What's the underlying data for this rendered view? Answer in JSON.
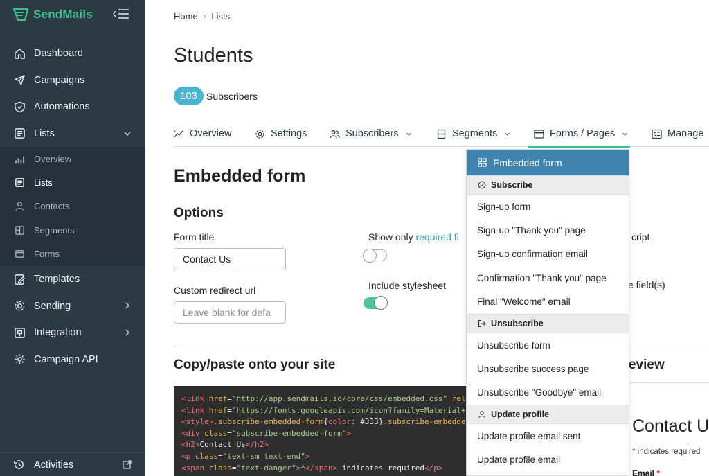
{
  "app": {
    "name": "SendMails",
    "brand_color": "#40c08f",
    "sidebar_bg": "#2c3a44"
  },
  "sidebar": {
    "items": [
      {
        "label": "Dashboard",
        "icon": "home-icon"
      },
      {
        "label": "Campaigns",
        "icon": "send-icon"
      },
      {
        "label": "Automations",
        "icon": "shield-check-icon"
      },
      {
        "label": "Lists",
        "icon": "list-icon",
        "expanded": true
      },
      {
        "label": "Templates",
        "icon": "edit-icon"
      },
      {
        "label": "Sending",
        "icon": "gear-icon"
      },
      {
        "label": "Integration",
        "icon": "plug-icon"
      },
      {
        "label": "Campaign API",
        "icon": "cog-icon"
      }
    ],
    "sub_items": [
      {
        "label": "Overview",
        "icon": "chart-icon"
      },
      {
        "label": "Lists",
        "icon": "list-icon",
        "active": true
      },
      {
        "label": "Contacts",
        "icon": "user-icon"
      },
      {
        "label": "Segments",
        "icon": "segment-icon"
      },
      {
        "label": "Forms",
        "icon": "form-icon"
      }
    ],
    "footer": {
      "label": "Activities",
      "icon": "history-icon"
    }
  },
  "breadcrumb": {
    "home": "Home",
    "sep": "›",
    "current": "Lists"
  },
  "page": {
    "title": "Students",
    "subscriber_count": "103",
    "subscriber_label": "Subscribers"
  },
  "tabs": [
    {
      "label": "Overview",
      "icon": "chart-line-icon"
    },
    {
      "label": "Settings",
      "icon": "gear-icon"
    },
    {
      "label": "Subscribers",
      "icon": "users-icon"
    },
    {
      "label": "Segments",
      "icon": "segments-icon"
    },
    {
      "label": "Forms / Pages",
      "icon": "window-icon",
      "active": true
    },
    {
      "label": "Manage",
      "icon": "checklist-icon"
    }
  ],
  "section": {
    "title": "Embedded form",
    "options_title": "Options"
  },
  "options": {
    "form_title_label": "Form title",
    "form_title_value": "Contact Us",
    "redirect_label": "Custom redirect url",
    "redirect_placeholder": "Leave blank for defa",
    "required_only_prefix": "Show only ",
    "required_only_link": "required fi",
    "required_only_on": false,
    "stylesheet_label": "Include stylesheet",
    "stylesheet_on": true,
    "partial_1": "cript",
    "partial_2": "e field(s)"
  },
  "copy": {
    "title": "Copy/paste onto your site",
    "preview_title_partial": "eview",
    "code_lines": [
      [
        {
          "c": "t",
          "v": "<link "
        },
        {
          "c": "a",
          "v": "href"
        },
        {
          "c": "",
          "v": "="
        },
        {
          "c": "s",
          "v": "\"http://app.sendmails.io/core/css/embedded.css\""
        },
        {
          "c": "",
          "v": " "
        },
        {
          "c": "a",
          "v": "rel="
        }
      ],
      [
        {
          "c": "t",
          "v": "<link "
        },
        {
          "c": "a",
          "v": "href"
        },
        {
          "c": "",
          "v": "="
        },
        {
          "c": "s",
          "v": "\"https://fonts.googleapis.com/icon?family=Material+I"
        }
      ],
      [
        {
          "c": "t",
          "v": "<style>"
        },
        {
          "c": "a",
          "v": ".subscribe-embedded-form"
        },
        {
          "c": "",
          "v": "{"
        },
        {
          "c": "t",
          "v": "color"
        },
        {
          "c": "",
          "v": ": #333}"
        },
        {
          "c": "a",
          "v": ".subscribe-embedded"
        }
      ],
      [
        {
          "c": "t",
          "v": "<div "
        },
        {
          "c": "a",
          "v": "class"
        },
        {
          "c": "",
          "v": "="
        },
        {
          "c": "s",
          "v": "\"subscribe-embedded-form\""
        },
        {
          "c": "t",
          "v": ">"
        }
      ],
      [
        {
          "c": "t",
          "v": "<h2>"
        },
        {
          "c": "",
          "v": "Contact Us"
        },
        {
          "c": "t",
          "v": "</h2>"
        }
      ],
      [
        {
          "c": "t",
          "v": "<p "
        },
        {
          "c": "a",
          "v": "class"
        },
        {
          "c": "",
          "v": "="
        },
        {
          "c": "s",
          "v": "\"text-sm text-end\""
        },
        {
          "c": "t",
          "v": ">"
        }
      ],
      [
        {
          "c": "t",
          "v": "<span "
        },
        {
          "c": "a",
          "v": "class"
        },
        {
          "c": "",
          "v": "="
        },
        {
          "c": "s",
          "v": "\"text-danger\""
        },
        {
          "c": "t",
          "v": ">"
        },
        {
          "c": "",
          "v": "*"
        },
        {
          "c": "t",
          "v": "</span>"
        },
        {
          "c": "",
          "v": " indicates required"
        },
        {
          "c": "t",
          "v": "</p>"
        }
      ]
    ]
  },
  "preview": {
    "title": "Contact U",
    "required_star": "*",
    "required_text": " indicates required",
    "email_label": "Email",
    "email_star": "*"
  },
  "dropdown": {
    "active_item": "Embedded form",
    "groups": [
      {
        "header": "Subscribe",
        "icon": "check-circle-icon",
        "items": [
          "Sign-up form",
          "Sign-up \"Thank you\" page",
          "Sign-up confirmation email",
          "Confirmation \"Thank you\" page",
          "Final \"Welcome\" email"
        ]
      },
      {
        "header": "Unsubscribe",
        "icon": "logout-icon",
        "items": [
          "Unsubscribe form",
          "Unsubscribe success page",
          "Unsubscribe \"Goodbye\" email"
        ]
      },
      {
        "header": "Update profile",
        "icon": "person-icon",
        "items": [
          "Update profile email sent",
          "Update profile email"
        ]
      }
    ],
    "active_color": "#3f84ae"
  }
}
